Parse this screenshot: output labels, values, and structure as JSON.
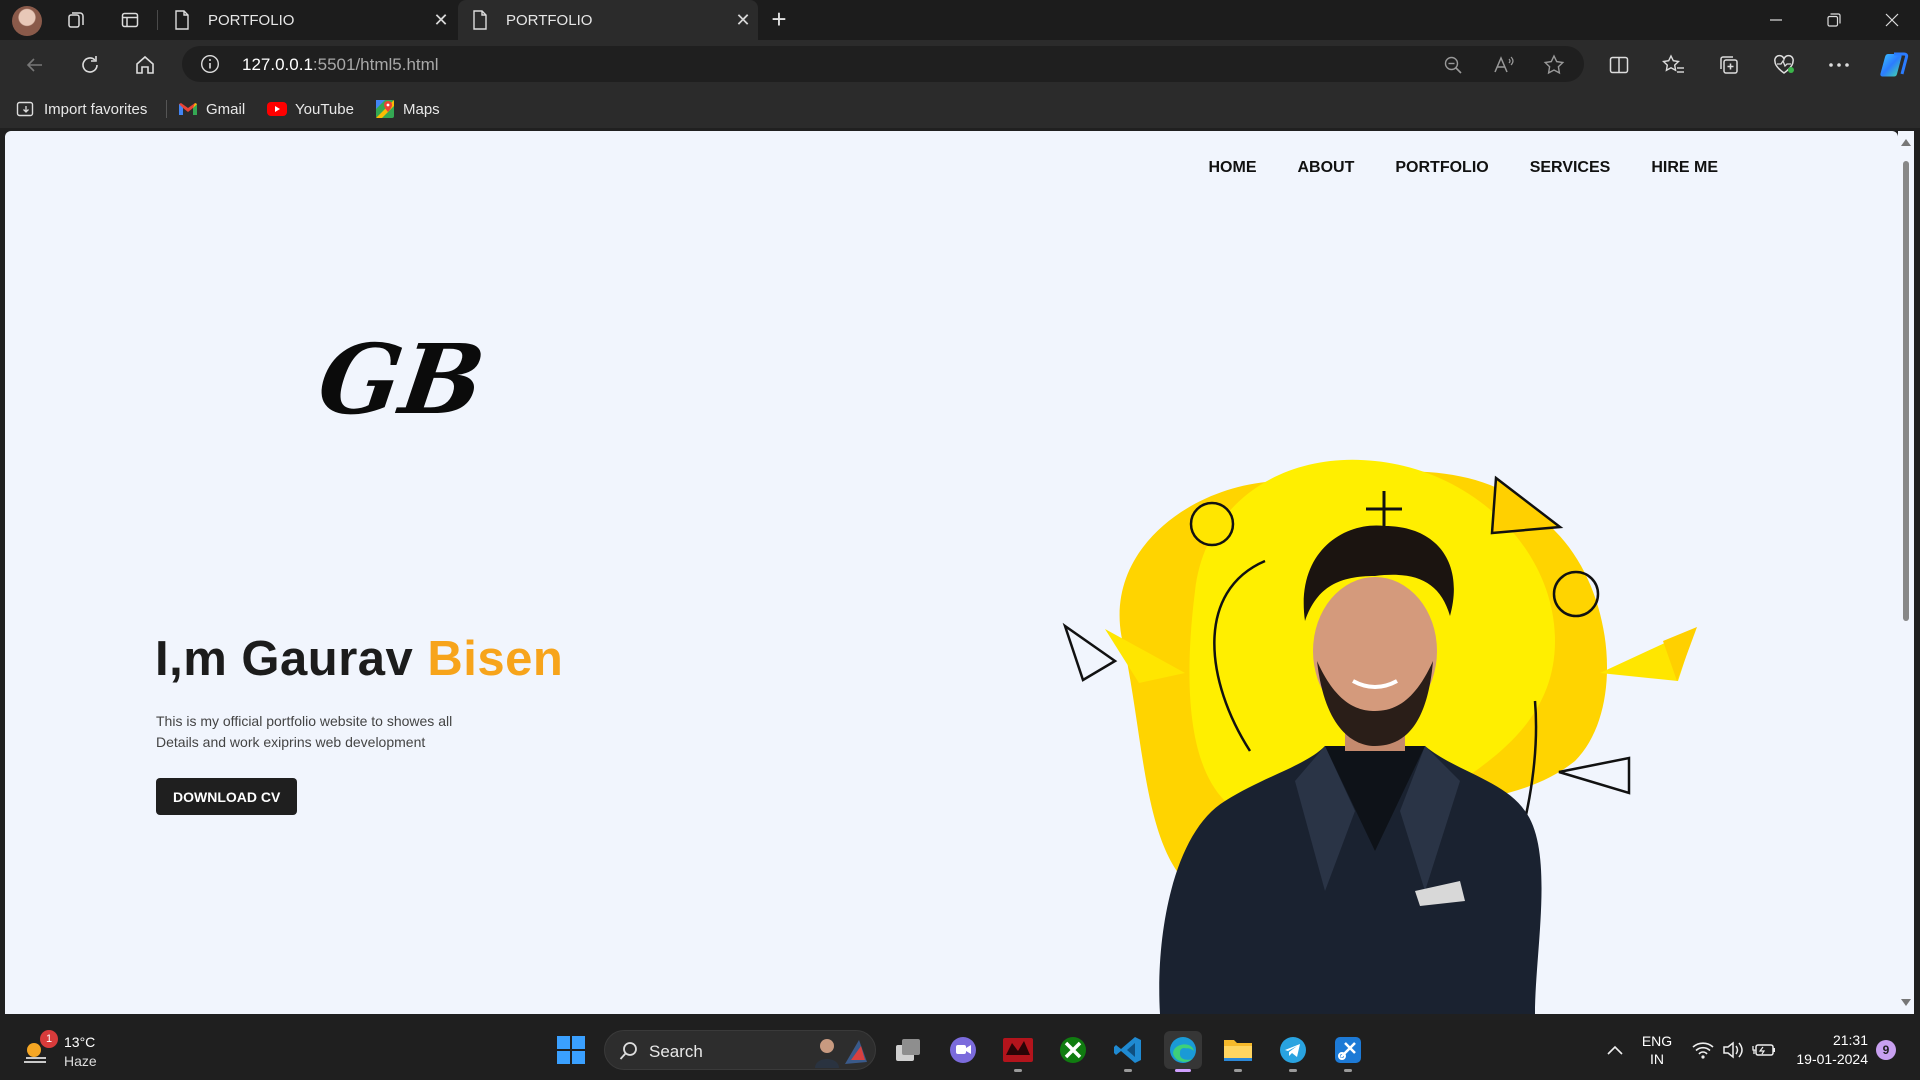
{
  "browser": {
    "tabs": [
      {
        "title": "PORTFOLIO",
        "active": false
      },
      {
        "title": "PORTFOLIO",
        "active": true
      }
    ],
    "address": {
      "host": "127.0.0.1",
      "rest": ":5501/html5.html"
    },
    "favorites": [
      {
        "label": "Import favorites",
        "icon": "import-favorites-icon"
      },
      {
        "label": "Gmail",
        "icon": "gmail-icon"
      },
      {
        "label": "YouTube",
        "icon": "youtube-icon"
      },
      {
        "label": "Maps",
        "icon": "maps-icon"
      }
    ]
  },
  "page": {
    "nav": [
      "HOME",
      "ABOUT",
      "PORTFOLIO",
      "SERVICES",
      "HIRE ME"
    ],
    "logo_text": "GB",
    "hero": {
      "title_prefix": "I,m Gaurav ",
      "title_accent": "Bisen",
      "desc_line1": "This is my official portfolio website to showes all",
      "desc_line2": "Details and work exiprins web development",
      "cta": "DOWNLOAD CV"
    },
    "colors": {
      "accent": "#f7a41b",
      "yellow": "#ffee00",
      "background": "#f1f5fd"
    }
  },
  "taskbar": {
    "weather": {
      "temp": "13°C",
      "condition": "Haze",
      "badge": "1"
    },
    "search_placeholder": "Search",
    "language": {
      "line1": "ENG",
      "line2": "IN"
    },
    "time": "21:31",
    "date": "19-01-2024",
    "notifications": "9"
  }
}
